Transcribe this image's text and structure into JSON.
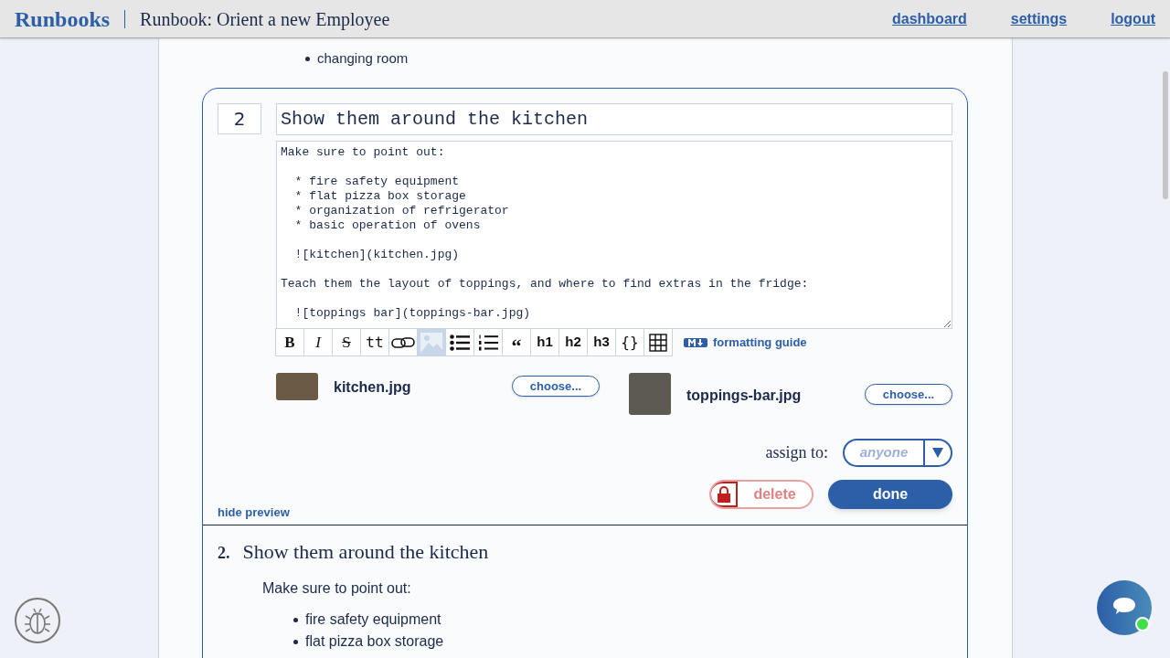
{
  "header": {
    "logo": "Runbooks",
    "title": "Runbook: Orient a new Employee",
    "links": [
      {
        "label": "dashboard"
      },
      {
        "label": "settings"
      },
      {
        "label": "logout"
      }
    ]
  },
  "previous_list": [
    "changing room"
  ],
  "step": {
    "number": "2",
    "title": "Show them around the kitchen",
    "body": "Make sure to point out:\n\n  * fire safety equipment\n  * flat pizza box storage\n  * organization of refrigerator\n  * basic operation of ovens\n\n  ![kitchen](kitchen.jpg)\n\nTeach them the layout of toppings, and where to find extras in the fridge:\n\n  ![toppings bar](toppings-bar.jpg)",
    "toolbar": [
      {
        "kind": "bold",
        "label": "B",
        "active": false
      },
      {
        "kind": "italic",
        "label": "I",
        "active": false
      },
      {
        "kind": "strike",
        "label": "S",
        "active": false
      },
      {
        "kind": "code",
        "label": "tt",
        "active": false
      },
      {
        "kind": "link",
        "active": false
      },
      {
        "kind": "image",
        "active": true
      },
      {
        "kind": "bullets",
        "active": false
      },
      {
        "kind": "numbers",
        "active": false
      },
      {
        "kind": "quote",
        "label": "“",
        "active": false
      },
      {
        "kind": "h1",
        "label": "h1",
        "active": false
      },
      {
        "kind": "h2",
        "label": "h2",
        "active": false
      },
      {
        "kind": "h3",
        "label": "h3",
        "active": false
      },
      {
        "kind": "codeblock",
        "label": "{}",
        "active": false
      },
      {
        "kind": "table",
        "active": false
      }
    ],
    "formatting_guide": "formatting guide",
    "attachments": [
      {
        "name": "kitchen.jpg",
        "button": "choose..."
      },
      {
        "name": "toppings-bar.jpg",
        "button": "choose..."
      }
    ],
    "assign_label": "assign to:",
    "assign_placeholder": "anyone",
    "delete": {
      "label": "delete",
      "locked": true
    },
    "done": "done",
    "hide_preview": "hide preview"
  },
  "preview": {
    "number": "2.",
    "title": "Show them around the kitchen",
    "intro": "Make sure to point out:",
    "items": [
      "fire safety equipment",
      "flat pizza box storage"
    ]
  },
  "chat": {
    "online": true
  }
}
